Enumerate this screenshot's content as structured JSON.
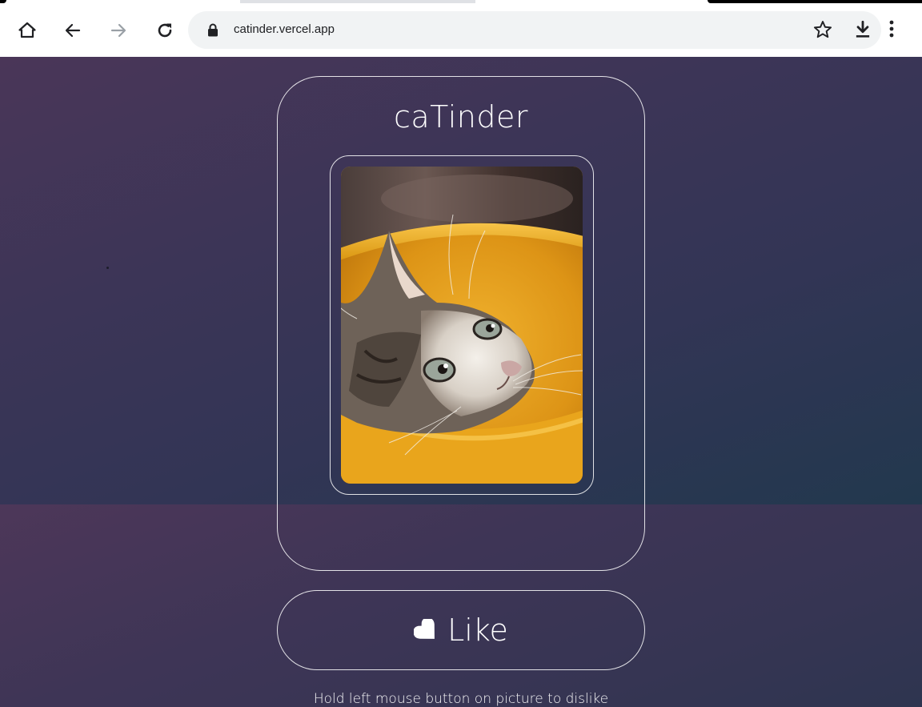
{
  "browser": {
    "url": "catinder.vercel.app",
    "icons": {
      "home": "home-icon",
      "back": "back-arrow-icon",
      "forward": "forward-arrow-icon",
      "reload": "reload-icon",
      "lock": "lock-icon",
      "bookmark": "star-icon",
      "download": "download-icon",
      "menu": "more-vert-icon"
    }
  },
  "app": {
    "title": "caTinder",
    "photo_alt": "kitten in a yellow bowl",
    "like_label": "Like",
    "hint": "Hold left mouse button on picture to dislike"
  },
  "colors": {
    "background_top": "#3c3557",
    "background_bottom_right": "#22384e",
    "outline": "#ffffff",
    "toolbar": "#ffffff",
    "omnibox": "#f1f3f4"
  }
}
